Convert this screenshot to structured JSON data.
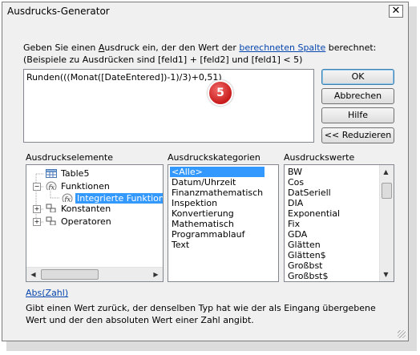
{
  "window": {
    "title": "Ausdrucks-Generator",
    "close_glyph": "✕"
  },
  "intro": {
    "line1_pre": "Geben Sie einen ",
    "line1_u": "A",
    "line1_mid": "usdruck ein, der den Wert der ",
    "line1_link": "berechneten Spalte",
    "line1_post": " berechnet:",
    "line2": "(Beispiele zu Ausdrücken sind [feld1] + [feld2] und [feld1] < 5)"
  },
  "expression": {
    "value": "Runden(((Monat([DateEntered])-1)/3)+0,51)"
  },
  "callout": {
    "number": "5"
  },
  "buttons": {
    "ok": "OK",
    "cancel": "Abbrechen",
    "help": "Hilfe",
    "reduce": "<< Reduzieren"
  },
  "elements": {
    "label": "Ausdruckselemente",
    "tree": [
      {
        "label": "Table5",
        "icon": "table-icon"
      },
      {
        "label": "Funktionen",
        "icon": "function-icon"
      },
      {
        "label": "Integrierte Funktionen",
        "icon": "function-icon",
        "selected": true
      },
      {
        "label": "Konstanten",
        "icon": "constants-icon"
      },
      {
        "label": "Operatoren",
        "icon": "operators-icon"
      }
    ]
  },
  "categories": {
    "label": "Ausdruckskategorien",
    "items": [
      "<Alle>",
      "Datum/Uhrzeit",
      "Finanzmathematisch",
      "Inspektion",
      "Konvertierung",
      "Mathematisch",
      "Programmablauf",
      "Text"
    ]
  },
  "values": {
    "label": "Ausdruckswerte",
    "items": [
      "BW",
      "Cos",
      "DatSeriell",
      "DIA",
      "Exponential",
      "Fix",
      "GDA",
      "Glätten",
      "Glätten$",
      "Großbst",
      "Großbst$"
    ]
  },
  "function_help": {
    "link": "Abs(Zahl)",
    "description": "Gibt einen Wert zurück, der denselben Typ hat wie der als Eingang übergebene Wert und der den absoluten Wert einer Zahl angibt."
  },
  "colors": {
    "selection": "#3399ff",
    "link": "#0645ad",
    "badge": "#d32626"
  }
}
